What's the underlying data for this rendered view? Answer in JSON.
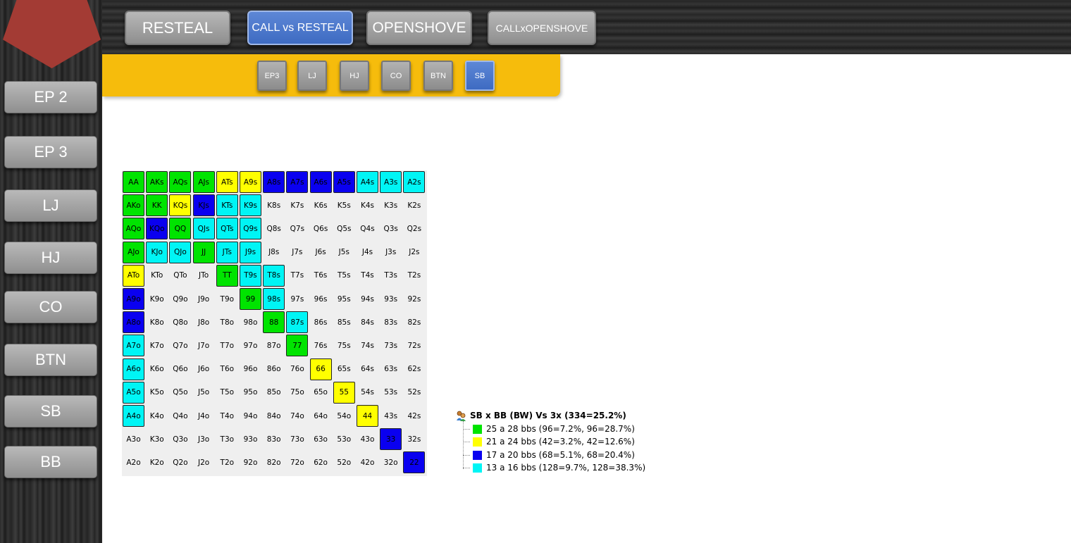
{
  "sidebar": {
    "items": [
      {
        "label": "EP 2"
      },
      {
        "label": "EP 3"
      },
      {
        "label": "LJ"
      },
      {
        "label": "HJ"
      },
      {
        "label": "CO"
      },
      {
        "label": "BTN"
      },
      {
        "label": "SB"
      },
      {
        "label": "BB"
      }
    ]
  },
  "top_tabs": [
    {
      "label": "RESTEAL",
      "active": false
    },
    {
      "label": "CALL vs RESTEAL",
      "active": true
    },
    {
      "label": "OPENSHOVE",
      "active": false
    },
    {
      "label": "CALLxOPENSHOVE",
      "active": false
    }
  ],
  "position_tabs": [
    {
      "label": "EP3",
      "active": false
    },
    {
      "label": "LJ",
      "active": false
    },
    {
      "label": "HJ",
      "active": false
    },
    {
      "label": "CO",
      "active": false
    },
    {
      "label": "BTN",
      "active": false
    },
    {
      "label": "SB",
      "active": true
    }
  ],
  "colors": {
    "green": "#00e400",
    "yellow": "#ffff00",
    "blue": "#0a00f0",
    "cyan": "#00f5f5",
    "accent_blue": "#4a76cc",
    "brand_red": "#a33b34",
    "bar_yellow": "#f6bc0c"
  },
  "hand_grid": {
    "rows": [
      [
        "AA",
        "AKs",
        "AQs",
        "AJs",
        "ATs",
        "A9s",
        "A8s",
        "A7s",
        "A6s",
        "A5s",
        "A4s",
        "A3s",
        "A2s"
      ],
      [
        "AKo",
        "KK",
        "KQs",
        "KJs",
        "KTs",
        "K9s",
        "K8s",
        "K7s",
        "K6s",
        "K5s",
        "K4s",
        "K3s",
        "K2s"
      ],
      [
        "AQo",
        "KQo",
        "QQ",
        "QJs",
        "QTs",
        "Q9s",
        "Q8s",
        "Q7s",
        "Q6s",
        "Q5s",
        "Q4s",
        "Q3s",
        "Q2s"
      ],
      [
        "AJo",
        "KJo",
        "QJo",
        "JJ",
        "JTs",
        "J9s",
        "J8s",
        "J7s",
        "J6s",
        "J5s",
        "J4s",
        "J3s",
        "J2s"
      ],
      [
        "ATo",
        "KTo",
        "QTo",
        "JTo",
        "TT",
        "T9s",
        "T8s",
        "T7s",
        "T6s",
        "T5s",
        "T4s",
        "T3s",
        "T2s"
      ],
      [
        "A9o",
        "K9o",
        "Q9o",
        "J9o",
        "T9o",
        "99",
        "98s",
        "97s",
        "96s",
        "95s",
        "94s",
        "93s",
        "92s"
      ],
      [
        "A8o",
        "K8o",
        "Q8o",
        "J8o",
        "T8o",
        "98o",
        "88",
        "87s",
        "86s",
        "85s",
        "84s",
        "83s",
        "82s"
      ],
      [
        "A7o",
        "K7o",
        "Q7o",
        "J7o",
        "T7o",
        "97o",
        "87o",
        "77",
        "76s",
        "75s",
        "74s",
        "73s",
        "72s"
      ],
      [
        "A6o",
        "K6o",
        "Q6o",
        "J6o",
        "T6o",
        "96o",
        "86o",
        "76o",
        "66",
        "65s",
        "64s",
        "63s",
        "62s"
      ],
      [
        "A5o",
        "K5o",
        "Q5o",
        "J5o",
        "T5o",
        "95o",
        "85o",
        "75o",
        "65o",
        "55",
        "54s",
        "53s",
        "52s"
      ],
      [
        "A4o",
        "K4o",
        "Q4o",
        "J4o",
        "T4o",
        "94o",
        "84o",
        "74o",
        "64o",
        "54o",
        "44",
        "43s",
        "42s"
      ],
      [
        "A3o",
        "K3o",
        "Q3o",
        "J3o",
        "T3o",
        "93o",
        "83o",
        "73o",
        "63o",
        "53o",
        "43o",
        "33",
        "32s"
      ],
      [
        "A2o",
        "K2o",
        "Q2o",
        "J2o",
        "T2o",
        "92o",
        "82o",
        "72o",
        "62o",
        "52o",
        "42o",
        "32o",
        "22"
      ]
    ],
    "color_codes": [
      [
        "g",
        "g",
        "g",
        "g",
        "y",
        "y",
        "b",
        "b",
        "b",
        "b",
        "c",
        "c",
        "c"
      ],
      [
        "g",
        "g",
        "y",
        "b",
        "c",
        "c",
        "",
        "",
        "",
        "",
        "",
        "",
        ""
      ],
      [
        "g",
        "b",
        "g",
        "c",
        "c",
        "c",
        "",
        "",
        "",
        "",
        "",
        "",
        ""
      ],
      [
        "g",
        "c",
        "c",
        "g",
        "c",
        "c",
        "",
        "",
        "",
        "",
        "",
        "",
        ""
      ],
      [
        "y",
        "",
        "",
        "",
        "g",
        "c",
        "c",
        "",
        "",
        "",
        "",
        "",
        ""
      ],
      [
        "b",
        "",
        "",
        "",
        "",
        "g",
        "c",
        "",
        "",
        "",
        "",
        "",
        ""
      ],
      [
        "b",
        "",
        "",
        "",
        "",
        "",
        "g",
        "c",
        "",
        "",
        "",
        "",
        ""
      ],
      [
        "c",
        "",
        "",
        "",
        "",
        "",
        "",
        "g",
        "",
        "",
        "",
        "",
        ""
      ],
      [
        "c",
        "",
        "",
        "",
        "",
        "",
        "",
        "",
        "y",
        "",
        "",
        "",
        ""
      ],
      [
        "c",
        "",
        "",
        "",
        "",
        "",
        "",
        "",
        "",
        "y",
        "",
        "",
        ""
      ],
      [
        "c",
        "",
        "",
        "",
        "",
        "",
        "",
        "",
        "",
        "",
        "y",
        "",
        ""
      ],
      [
        "",
        "",
        "",
        "",
        "",
        "",
        "",
        "",
        "",
        "",
        "",
        "b",
        ""
      ],
      [
        "",
        "",
        "",
        "",
        "",
        "",
        "",
        "",
        "",
        "",
        "",
        "",
        "b"
      ]
    ]
  },
  "legend": {
    "title": "SB x BB (BW) Vs 3x (334=25.2%)",
    "items": [
      {
        "label": "25 a 28 bbs (96=7.2%, 96=28.7%)",
        "color": "#00e400"
      },
      {
        "label": "21 a 24 bbs (42=3.2%, 42=12.6%)",
        "color": "#ffff00"
      },
      {
        "label": "17 a 20 bbs (68=5.1%, 68=20.4%)",
        "color": "#0a00f0"
      },
      {
        "label": "13 a 16 bbs (128=9.7%, 128=38.3%)",
        "color": "#00f5f5"
      }
    ]
  }
}
